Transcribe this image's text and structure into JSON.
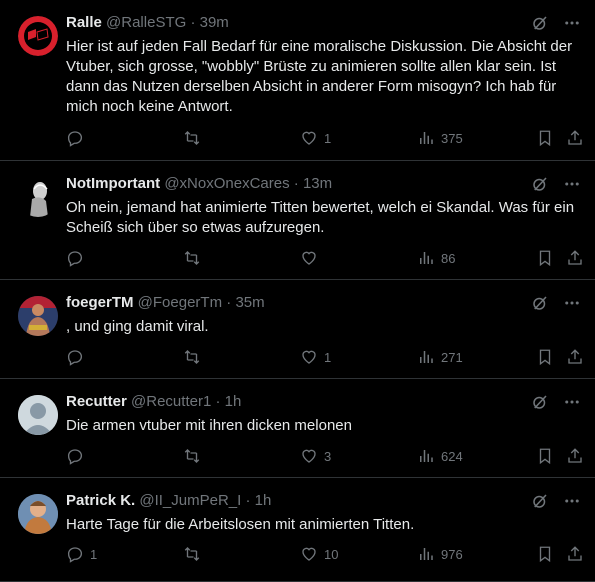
{
  "tweets": [
    {
      "display_name": "Ralle",
      "handle": "@RalleSTG",
      "time": "39m",
      "text": "Hier ist auf jeden Fall Bedarf für eine moralische Diskussion. Die Absicht der Vtuber, sich grosse, \"wobbly\" Brüste zu animieren sollte allen klar sein. Ist dann das Nutzen derselben Absicht in anderer Form misogyn? Ich hab für mich noch keine Antwort.",
      "replies": "",
      "reposts": "",
      "likes": "1",
      "views": "375",
      "avatar": "antifa-flag-avatar"
    },
    {
      "display_name": "NotImportant",
      "handle": "@xNoxOnexCares",
      "time": "13m",
      "text": "Oh nein, jemand hat animierte Titten bewertet, welch ei Skandal. Was für ein Scheiß sich über so etwas aufzuregen.",
      "replies": "",
      "reposts": "",
      "likes": "",
      "views": "86",
      "avatar": "dark-figure-avatar"
    },
    {
      "display_name": "foegerTM",
      "handle": "@FoegerTm",
      "time": "35m",
      "text": ", und ging damit viral.",
      "replies": "",
      "reposts": "",
      "likes": "1",
      "views": "271",
      "avatar": "wrestler-avatar"
    },
    {
      "display_name": "Recutter",
      "handle": "@Recutter1",
      "time": "1h",
      "text": "Die armen vtuber mit ihren dicken melonen",
      "replies": "",
      "reposts": "",
      "likes": "3",
      "views": "624",
      "avatar": "default-avatar"
    },
    {
      "display_name": "Patrick K.",
      "handle": "@II_JumPeR_I",
      "time": "1h",
      "text": "Harte Tage für die Arbeitslosen mit animierten Titten.",
      "replies": "1",
      "reposts": "",
      "likes": "10",
      "views": "976",
      "avatar": "cartoon-avatar"
    }
  ],
  "ui": {
    "dot": "·",
    "more": "···"
  },
  "colors": {
    "background": "#000000",
    "text": "#e7e9ea",
    "muted": "#71767b",
    "divider": "#2f3336"
  }
}
